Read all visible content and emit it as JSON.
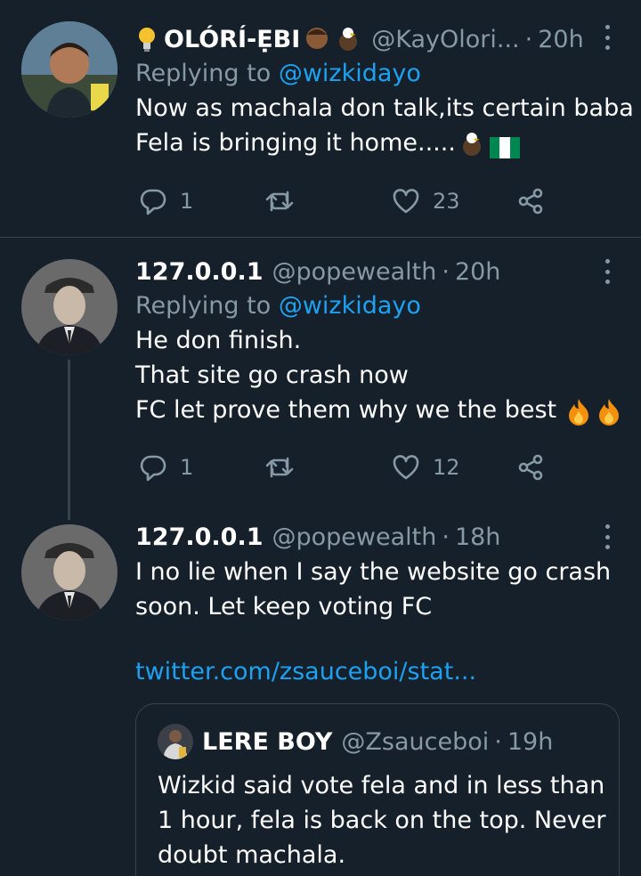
{
  "colors": {
    "background": "#15202b",
    "text": "#ffffff",
    "muted": "#8899a6",
    "accent": "#1da1f2",
    "divider": "#38444d"
  },
  "tweets": [
    {
      "name": "OLÓRÍ-ẸBI",
      "handle": "@KayOlori...",
      "time": "20h",
      "replying_prefix": "Replying to",
      "replying_to": "@wizkidayo",
      "lines": [
        "Now as machala don talk,its certain baba",
        "Fela is bringing it home....."
      ],
      "replies": "1",
      "retweets": "",
      "likes": "23"
    },
    {
      "name": "127.0.0.1",
      "handle": "@popewealth",
      "time": "20h",
      "replying_prefix": "Replying to",
      "replying_to": "@wizkidayo",
      "lines": [
        "He don finish.",
        "That site go crash now",
        "FC let prove them why we the best"
      ],
      "replies": "1",
      "retweets": "",
      "likes": "12"
    },
    {
      "name": "127.0.0.1",
      "handle": "@popewealth",
      "time": "18h",
      "lines": [
        "I no lie when I say the website go crash",
        "soon. Let keep voting FC"
      ],
      "link": "twitter.com/zsauceboi/stat..."
    }
  ],
  "quote": {
    "name": "LERE BOY",
    "handle": "@Zsauceboi",
    "time": "19h",
    "lines": [
      "Wizkid said vote fela and in less than",
      "1 hour, fela is back on the top. Never",
      "doubt machala."
    ]
  },
  "icons": {
    "reply": "reply-icon",
    "retweet": "retweet-icon",
    "like": "heart-icon",
    "share": "share-icon",
    "more": "more-vertical-icon"
  }
}
